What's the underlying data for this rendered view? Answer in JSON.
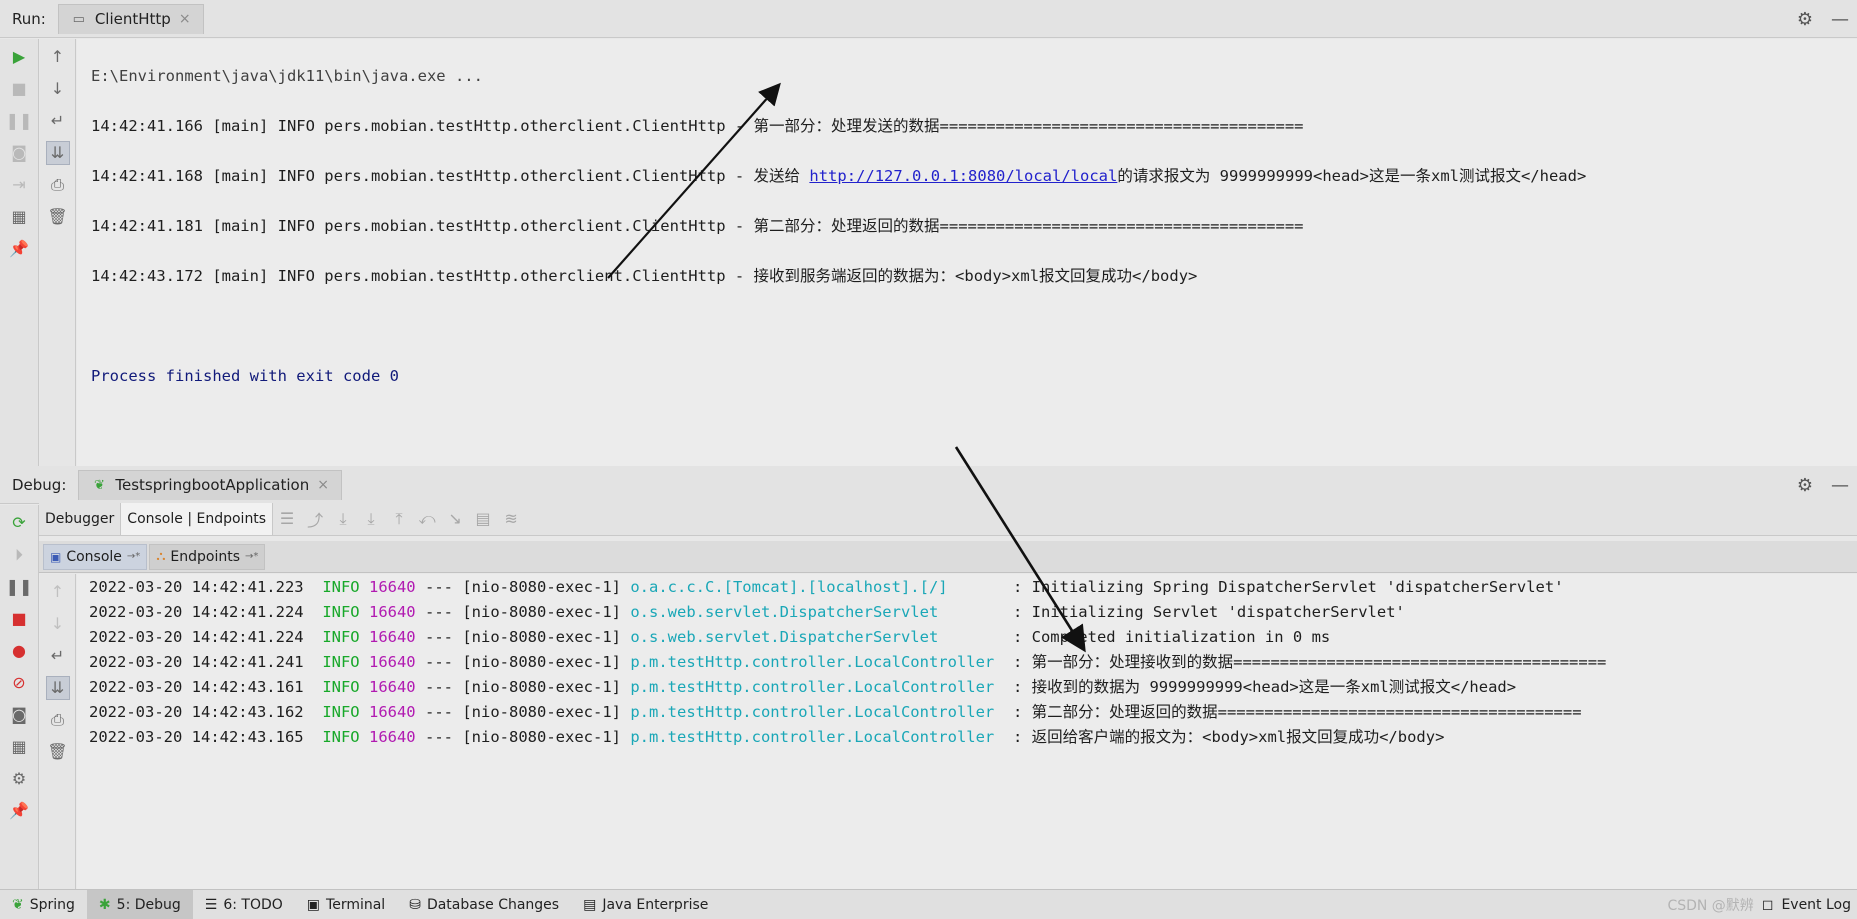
{
  "run_panel": {
    "label": "Run:",
    "tab_title": "ClientHttp",
    "tab_close": "×",
    "gear": "⚙",
    "minimize": "—"
  },
  "run_console": {
    "command": "E:\\Environment\\java\\jdk11\\bin\\java.exe ...",
    "lines": [
      {
        "text": "14:42:41.166 [main] INFO pers.mobian.testHttp.otherclient.ClientHttp - 第一部分：处理发送的数据======================================="
      },
      {
        "pre": "14:42:41.168 [main] INFO pers.mobian.testHttp.otherclient.ClientHttp - 发送给 ",
        "link": "http://127.0.0.1:8080/local/local",
        "post": "的请求报文为 9999999999<head>这是一条xml测试报文</head>"
      },
      {
        "text": "14:42:41.181 [main] INFO pers.mobian.testHttp.otherclient.ClientHttp - 第二部分：处理返回的数据======================================="
      },
      {
        "text": "14:42:43.172 [main] INFO pers.mobian.testHttp.otherclient.ClientHttp - 接收到服务端返回的数据为：<body>xml报文回复成功</body>"
      }
    ],
    "exit": "Process finished with exit code 0"
  },
  "debug_panel": {
    "label": "Debug:",
    "tab_title": "TestspringbootApplication",
    "tab_close": "×",
    "gear": "⚙",
    "minimize": "—",
    "tabs": [
      "Debugger",
      "Console | Endpoints"
    ],
    "subtabs": [
      "Console",
      "Endpoints"
    ],
    "pin": "→*"
  },
  "debug_console": {
    "lines": [
      {
        "date": "2022-03-20 14:42:41.223",
        "level": "INFO",
        "pid": "16640",
        "sep": "---",
        "thread": "[nio-8080-exec-1]",
        "logger": "o.a.c.c.C.[Tomcat].[localhost].[/]      ",
        "msg": ": Initializing Spring DispatcherServlet 'dispatcherServlet'"
      },
      {
        "date": "2022-03-20 14:42:41.224",
        "level": "INFO",
        "pid": "16640",
        "sep": "---",
        "thread": "[nio-8080-exec-1]",
        "logger": "o.s.web.servlet.DispatcherServlet       ",
        "msg": ": Initializing Servlet 'dispatcherServlet'"
      },
      {
        "date": "2022-03-20 14:42:41.224",
        "level": "INFO",
        "pid": "16640",
        "sep": "---",
        "thread": "[nio-8080-exec-1]",
        "logger": "o.s.web.servlet.DispatcherServlet       ",
        "msg": ": Completed initialization in 0 ms"
      },
      {
        "date": "2022-03-20 14:42:41.241",
        "level": "INFO",
        "pid": "16640",
        "sep": "---",
        "thread": "[nio-8080-exec-1]",
        "logger": "p.m.testHttp.controller.LocalController ",
        "msg": ": 第一部分：处理接收到的数据========================================"
      },
      {
        "date": "2022-03-20 14:42:43.161",
        "level": "INFO",
        "pid": "16640",
        "sep": "---",
        "thread": "[nio-8080-exec-1]",
        "logger": "p.m.testHttp.controller.LocalController ",
        "msg": ": 接收到的数据为 9999999999<head>这是一条xml测试报文</head>"
      },
      {
        "date": "2022-03-20 14:42:43.162",
        "level": "INFO",
        "pid": "16640",
        "sep": "---",
        "thread": "[nio-8080-exec-1]",
        "logger": "p.m.testHttp.controller.LocalController ",
        "msg": ": 第二部分：处理返回的数据======================================="
      },
      {
        "date": "2022-03-20 14:42:43.165",
        "level": "INFO",
        "pid": "16640",
        "sep": "---",
        "thread": "[nio-8080-exec-1]",
        "logger": "p.m.testHttp.controller.LocalController ",
        "msg": ": 返回给客户端的报文为：<body>xml报文回复成功</body>"
      }
    ]
  },
  "statusbar": {
    "items": [
      "Spring",
      "5: Debug",
      "6: TODO",
      "Terminal",
      "Database Changes",
      "Java Enterprise"
    ],
    "event_log": "Event Log",
    "watermark": "CSDN @默辨"
  },
  "colors": {
    "info": "#17a829",
    "pid": "#b11ab1",
    "logger": "#1aa7b7",
    "link": "#2222cc",
    "exit": "#111a7a"
  }
}
